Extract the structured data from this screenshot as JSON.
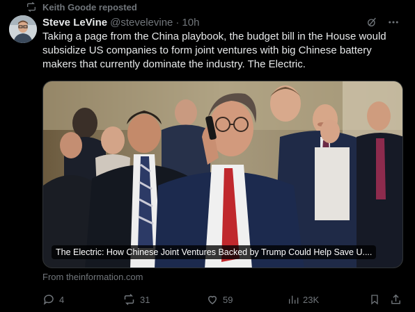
{
  "repost": {
    "text": "Keith Goode reposted"
  },
  "author": {
    "name": "Steve LeVine",
    "handle": "@stevelevine",
    "time": "10h"
  },
  "tweet": {
    "text": "Taking a page from the China playbook, the budget bill in the House would subsidize US companies to form joint ventures with big Chinese battery makers that currently dominate the industry. The Electric."
  },
  "card": {
    "caption": "The Electric: How Chinese Joint Ventures Backed by Trump Could Help Save U....",
    "source": "From theinformation.com"
  },
  "actions": {
    "replies": "4",
    "reposts": "31",
    "likes": "59",
    "views": "23K"
  },
  "colors": {
    "background": "#000000",
    "text": "#e7e9ea",
    "muted": "#71767b",
    "border": "#2f3336"
  },
  "icons": [
    "repost-icon",
    "grok-icon",
    "more-icon",
    "reply-icon",
    "like-icon",
    "views-icon",
    "bookmark-icon",
    "share-icon"
  ]
}
